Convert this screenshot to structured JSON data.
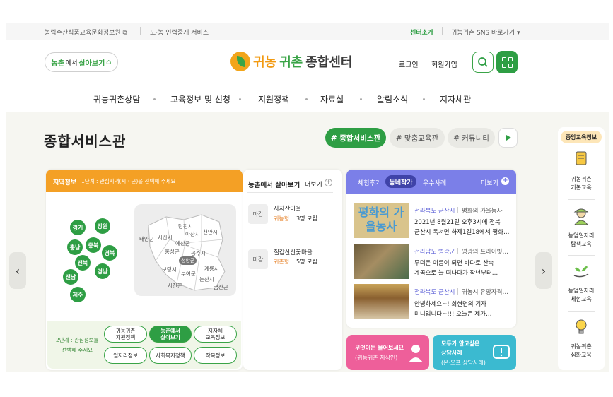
{
  "topbar": {
    "link1": "농림수산식품교육문화정보원 ⧉",
    "link2": "도·농 인력중개 서비스",
    "center_intro": "센터소개",
    "sns": "귀농귀촌 SNS 바로가기  ▾"
  },
  "header": {
    "pill_green": "농촌",
    "pill_mid": "에서",
    "pill_rest": "살아보기",
    "pill_icon": "⌂",
    "logo_t1": "귀농",
    "logo_t2": "귀촌",
    "logo_t3": "종합센터",
    "login": "로그인",
    "join": "회원가입"
  },
  "gnb": [
    "귀농귀촌상담",
    "교육정보 및 신청",
    "지원정책",
    "자료실",
    "알림소식",
    "지자체관"
  ],
  "main": {
    "title": "종합서비스관",
    "tags": [
      "# 종합서비스관",
      "# 맞춤교육관",
      "# 커뮤니티"
    ],
    "prev": "‹",
    "next": "›"
  },
  "region": {
    "title": "지역정보",
    "step1": "1단계 : 관심지역(시 · 군)을 선택해 주세요",
    "provinces": [
      "경기",
      "강원",
      "충남",
      "충북",
      "경북",
      "전북",
      "경남",
      "전남",
      "제주"
    ],
    "cities": [
      "당진시",
      "아산시",
      "천안시",
      "서산시",
      "태안군",
      "예산군",
      "홍성군",
      "공주시",
      "청양군",
      "보령시",
      "부여군",
      "계룡시",
      "논산시",
      "서천군",
      "금산군"
    ],
    "step2_line1": "2단계 : 관심정보를",
    "step2_line2": "선택해 주세요",
    "buttons": [
      [
        "귀농귀촌",
        "지원정책"
      ],
      [
        "농촌에서",
        "살아보기"
      ],
      [
        "지자체",
        "교육정보"
      ],
      [
        "일자리정보"
      ],
      [
        "사회복지정책"
      ],
      [
        "작목정보"
      ]
    ]
  },
  "farm": {
    "title": "농촌에서 살아보기",
    "more": "더보기",
    "plus": "+",
    "items": [
      {
        "status": "마감",
        "name": "사자산마을",
        "type": "귀농형",
        "count": "3명 모집"
      },
      {
        "status": "마감",
        "name": "칠갑산산꽃마을",
        "type": "귀촌형",
        "count": "5명 모집"
      }
    ]
  },
  "stories": {
    "tabs": [
      "체험후기",
      "동네작가",
      "우수사례"
    ],
    "more": "더보기",
    "plus": "+",
    "items": [
      {
        "loc": "전라북도 군산시",
        "title": "평화의 가을농사",
        "line1": "2021년 8월21일 오후3시에 전북",
        "line2": "군산시 옥서면 하제1길18에서 평화…",
        "thumb_text": "평화의 가을농사"
      },
      {
        "loc": "전라남도 영광군",
        "title": "영광의 프라이빗…",
        "line1": "무더운 여름이 되면 바다로 산속",
        "line2": "계곡으로 늘 떠나다가 작년부터…"
      },
      {
        "loc": "전라북도 군산시",
        "title": "귀농시 유망자격…",
        "line1": "안녕하세요~! 회현면의 기자",
        "line2": "미니입니다~!!! 오늘은 제가…"
      }
    ]
  },
  "banners": {
    "ask1": "무엇이든 물어보세요",
    "ask2": "(귀농귀촌 지식인)",
    "cases1": "모두가 알고싶은",
    "cases2": "상담사례",
    "cases3": "(온·오프 상담사례)"
  },
  "side": {
    "title": "중앙교육정보",
    "items": [
      [
        "귀농귀촌",
        "기본교육"
      ],
      [
        "농업일자리",
        "탐색교육"
      ],
      [
        "농업일자리",
        "체험교육"
      ],
      [
        "귀농귀촌",
        "심화교육"
      ]
    ]
  },
  "colors": {
    "green": "#2e9e44",
    "orange": "#f4a025",
    "purple": "#7b7fe8",
    "pink": "#ee5f9a",
    "teal": "#3bbad0"
  }
}
